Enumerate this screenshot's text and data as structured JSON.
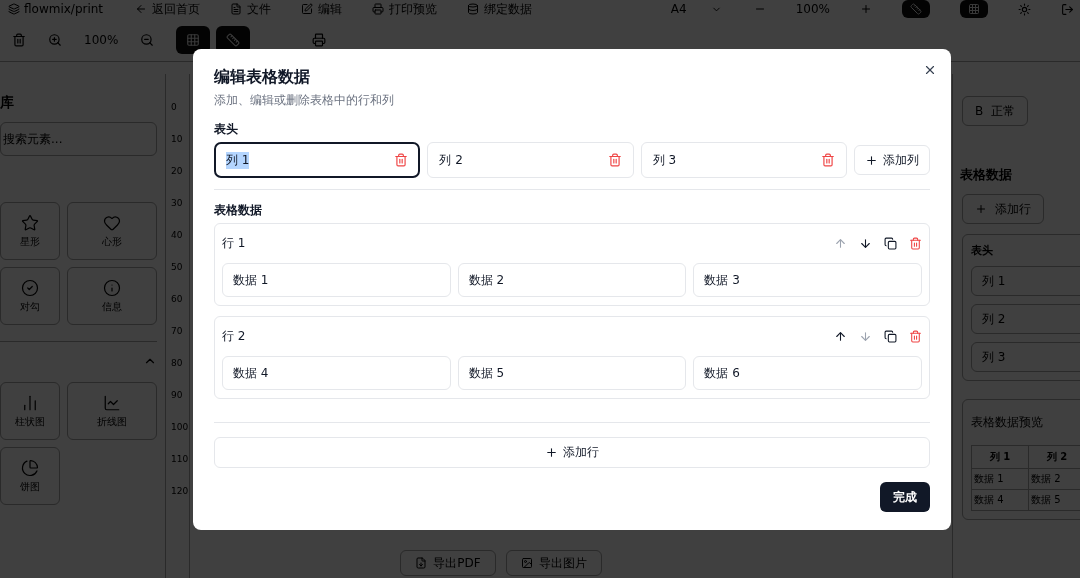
{
  "topbar": {
    "title": "flowmix/print",
    "nav": [
      {
        "label": "返回首页",
        "kind": "back"
      },
      {
        "label": "文件",
        "kind": "file"
      },
      {
        "label": "编辑",
        "kind": "edit"
      },
      {
        "label": "打印预览",
        "kind": "print"
      },
      {
        "label": "绑定数据",
        "kind": "data"
      }
    ],
    "paper": "A4",
    "zoom": "100%"
  },
  "toolbar": {
    "zoom": "100%"
  },
  "library": {
    "title": "库",
    "search_placeholder": "搜索元素...",
    "shapes": [
      {
        "label": "星形",
        "kind": "star"
      },
      {
        "label": "心形",
        "kind": "heart"
      },
      {
        "label": "对勾",
        "kind": "check"
      },
      {
        "label": "信息",
        "kind": "info"
      }
    ],
    "charts": [
      {
        "label": "柱状图",
        "kind": "bar"
      },
      {
        "label": "折线图",
        "kind": "line"
      },
      {
        "label": "饼图",
        "kind": "pie"
      }
    ]
  },
  "ruler": [
    "0",
    "10",
    "20",
    "30",
    "40",
    "50",
    "60",
    "70",
    "80",
    "90",
    "100",
    "110",
    "120"
  ],
  "properties": {
    "weight_glyph": "B",
    "weight": "正常",
    "section_title": "表格数据",
    "add_row": "添加行",
    "header_label": "表头",
    "columns": [
      "列 1",
      "列 2",
      "列 3"
    ],
    "preview_title": "表格数据预览",
    "preview": {
      "columns": [
        "列 1",
        "列 2"
      ],
      "rows": [
        [
          "数据 1",
          "数据 2"
        ],
        [
          "数据 4",
          "数据 5"
        ]
      ]
    }
  },
  "export": [
    {
      "label": "导出PDF",
      "kind": "pdf"
    },
    {
      "label": "导出图片",
      "kind": "image"
    }
  ],
  "dialog": {
    "title": "编辑表格数据",
    "subtitle": "添加、编辑或删除表格中的行和列",
    "header_label": "表头",
    "columns": [
      {
        "value": "列 1",
        "focused": true
      },
      {
        "value": "列 2",
        "focused": false
      },
      {
        "value": "列 3",
        "focused": false
      }
    ],
    "add_column": "添加列",
    "data_label": "表格数据",
    "rows": [
      {
        "label": "行 1",
        "can_move_up": false,
        "can_move_down": true,
        "cells": [
          "数据 1",
          "数据 2",
          "数据 3"
        ]
      },
      {
        "label": "行 2",
        "can_move_up": true,
        "can_move_down": false,
        "cells": [
          "数据 4",
          "数据 5",
          "数据 6"
        ]
      }
    ],
    "add_row": "添加行",
    "done": "完成"
  }
}
